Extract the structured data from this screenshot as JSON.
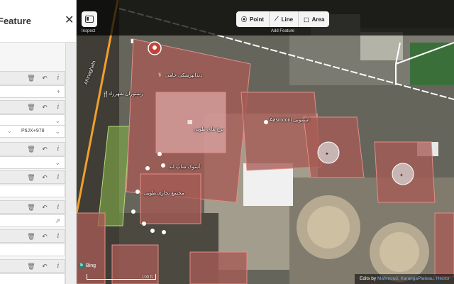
{
  "sidebar": {
    "title": "Feature",
    "close_icon": "close-icon",
    "fields": [
      {
        "value": "",
        "extra": "+"
      },
      {
        "value": "",
        "extra": "⌄"
      },
      {
        "value": "P6JX+978",
        "extra": "⌄"
      },
      {
        "value": "",
        "extra": "⌄"
      },
      {
        "value": "",
        "extra": ""
      },
      {
        "value": "",
        "extra": "⇗"
      },
      {
        "value": "",
        "extra": ""
      },
      {
        "value": "",
        "extra": ""
      }
    ]
  },
  "toolbar": {
    "inspect_label": "Inspect",
    "add_feature_label": "Add Feature",
    "point_label": "Point",
    "line_label": "Line",
    "area_label": "Area"
  },
  "map": {
    "road_label": "Afrinaghaln",
    "labels": {
      "dental_clinic": "دندانپزشکی حامی",
      "restaurant": "رستوران شهرزاد",
      "tower": "برج های طوبی",
      "aasmooni": "Aasmooni آسمونی",
      "shop": "آسوک شاپ لند",
      "mall": "مجتمع تجاری طوبی"
    },
    "colors": {
      "building_fill": "#a65b54",
      "building_stroke": "#e08f86",
      "selected_fill": "#7fa84a",
      "road": "#f0a02c"
    }
  },
  "bing_label": "Bing",
  "scale_label": "100 ft",
  "attribution": {
    "prefix": "Edits by ",
    "names": "Mahmoud, KarangaPlateau, Hector"
  }
}
